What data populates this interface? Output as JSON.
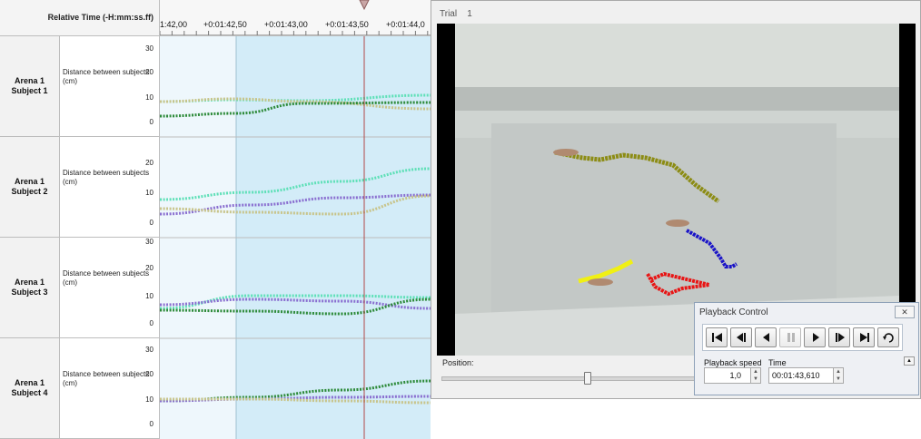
{
  "header": {
    "time_column_title": "Relative Time (-H:mm:ss.ff)",
    "ticks": [
      "1:42,00",
      "+0:01:42,50",
      "+0:01:43,00",
      "+0:01:43,50",
      "+0:01:44,0"
    ]
  },
  "rows": [
    {
      "name": "Arena 1\nSubject 1",
      "variable": "Distance between subjects (cm)",
      "y_ticks": [
        "30",
        "20",
        "10",
        "0"
      ]
    },
    {
      "name": "Arena 1\nSubject 2",
      "variable": "Distance between subjects (cm)",
      "y_ticks": [
        "20",
        "10",
        "0"
      ]
    },
    {
      "name": "Arena 1\nSubject 3",
      "variable": "Distance between subjects (cm)",
      "y_ticks": [
        "30",
        "20",
        "10",
        "0"
      ]
    },
    {
      "name": "Arena 1\nSubject 4",
      "variable": "Distance between subjects (cm)",
      "y_ticks": [
        "30",
        "20",
        "10",
        "0"
      ]
    }
  ],
  "video_window": {
    "title": "Trial",
    "trial_number": "1",
    "position_label": "Position:"
  },
  "playback": {
    "title": "Playback Control",
    "close_glyph": "✕",
    "speed_label": "Playback speed",
    "speed_value": "1,0",
    "time_label": "Time",
    "time_value": "00:01:43,610",
    "collapse_glyph": "▲",
    "buttons": [
      "first-frame",
      "step-back",
      "play-reverse",
      "pause",
      "play",
      "step-forward",
      "last-frame",
      "loop"
    ]
  },
  "colors": {
    "series_dark_green": "#2e8b3a",
    "series_aqua": "#5fe0b8",
    "series_purple": "#8a6fd0",
    "series_khaki": "#c8c48a",
    "cursor_line": "#b04848"
  }
}
